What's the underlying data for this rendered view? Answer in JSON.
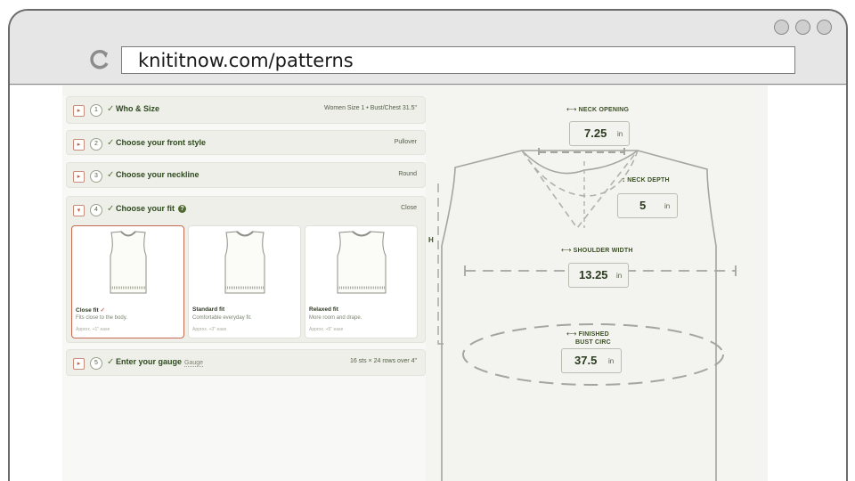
{
  "browser": {
    "url": "knititnow.com/patterns"
  },
  "steps": [
    {
      "number": "1",
      "title": "Who & Size",
      "summary": "Women  Size 1 • Bust/Chest 31.5\"",
      "toggle": "▸"
    },
    {
      "number": "2",
      "title": "Choose your front style",
      "summary": "Pullover",
      "toggle": "▸"
    },
    {
      "number": "3",
      "title": "Choose your neckline",
      "summary": "Round",
      "toggle": "▸"
    },
    {
      "number": "4",
      "title": "Choose your fit",
      "summary": "Close",
      "toggle": "▾"
    },
    {
      "number": "5",
      "title": "Enter your gauge",
      "gauge_label": "Gauge",
      "summary": "16 sts × 24 rows over 4\"",
      "toggle": "▸"
    }
  ],
  "check_mark": "✓",
  "info_mark": "?",
  "fit_options": [
    {
      "name": "Close fit",
      "selected_mark": "✓",
      "description": "Fits close to the body.",
      "ease": "Approx. +1\" ease",
      "selected": true
    },
    {
      "name": "Standard fit",
      "selected_mark": "",
      "description": "Comfortable everyday fit.",
      "ease": "Approx. +3\" ease",
      "selected": false
    },
    {
      "name": "Relaxed fit",
      "selected_mark": "",
      "description": "More room and drape.",
      "ease": "Approx. +5\" ease",
      "selected": false
    }
  ],
  "measurements": {
    "neck_opening": {
      "label": "NECK OPENING",
      "value": "7.25",
      "unit": "in"
    },
    "neck_depth": {
      "label": "NECK DEPTH",
      "value": "5",
      "unit": "in"
    },
    "shoulder_width": {
      "label": "SHOULDER WIDTH",
      "value": "13.25",
      "unit": "in"
    },
    "bust_circ": {
      "label_line1": "FINISHED",
      "label_line2": "BUST CIRC",
      "value": "37.5",
      "unit": "in"
    },
    "side_letter": "H"
  },
  "colors": {
    "accent_green": "#2f4a1f",
    "accent_red": "#c86a52",
    "panel_bg": "#edefe8"
  }
}
